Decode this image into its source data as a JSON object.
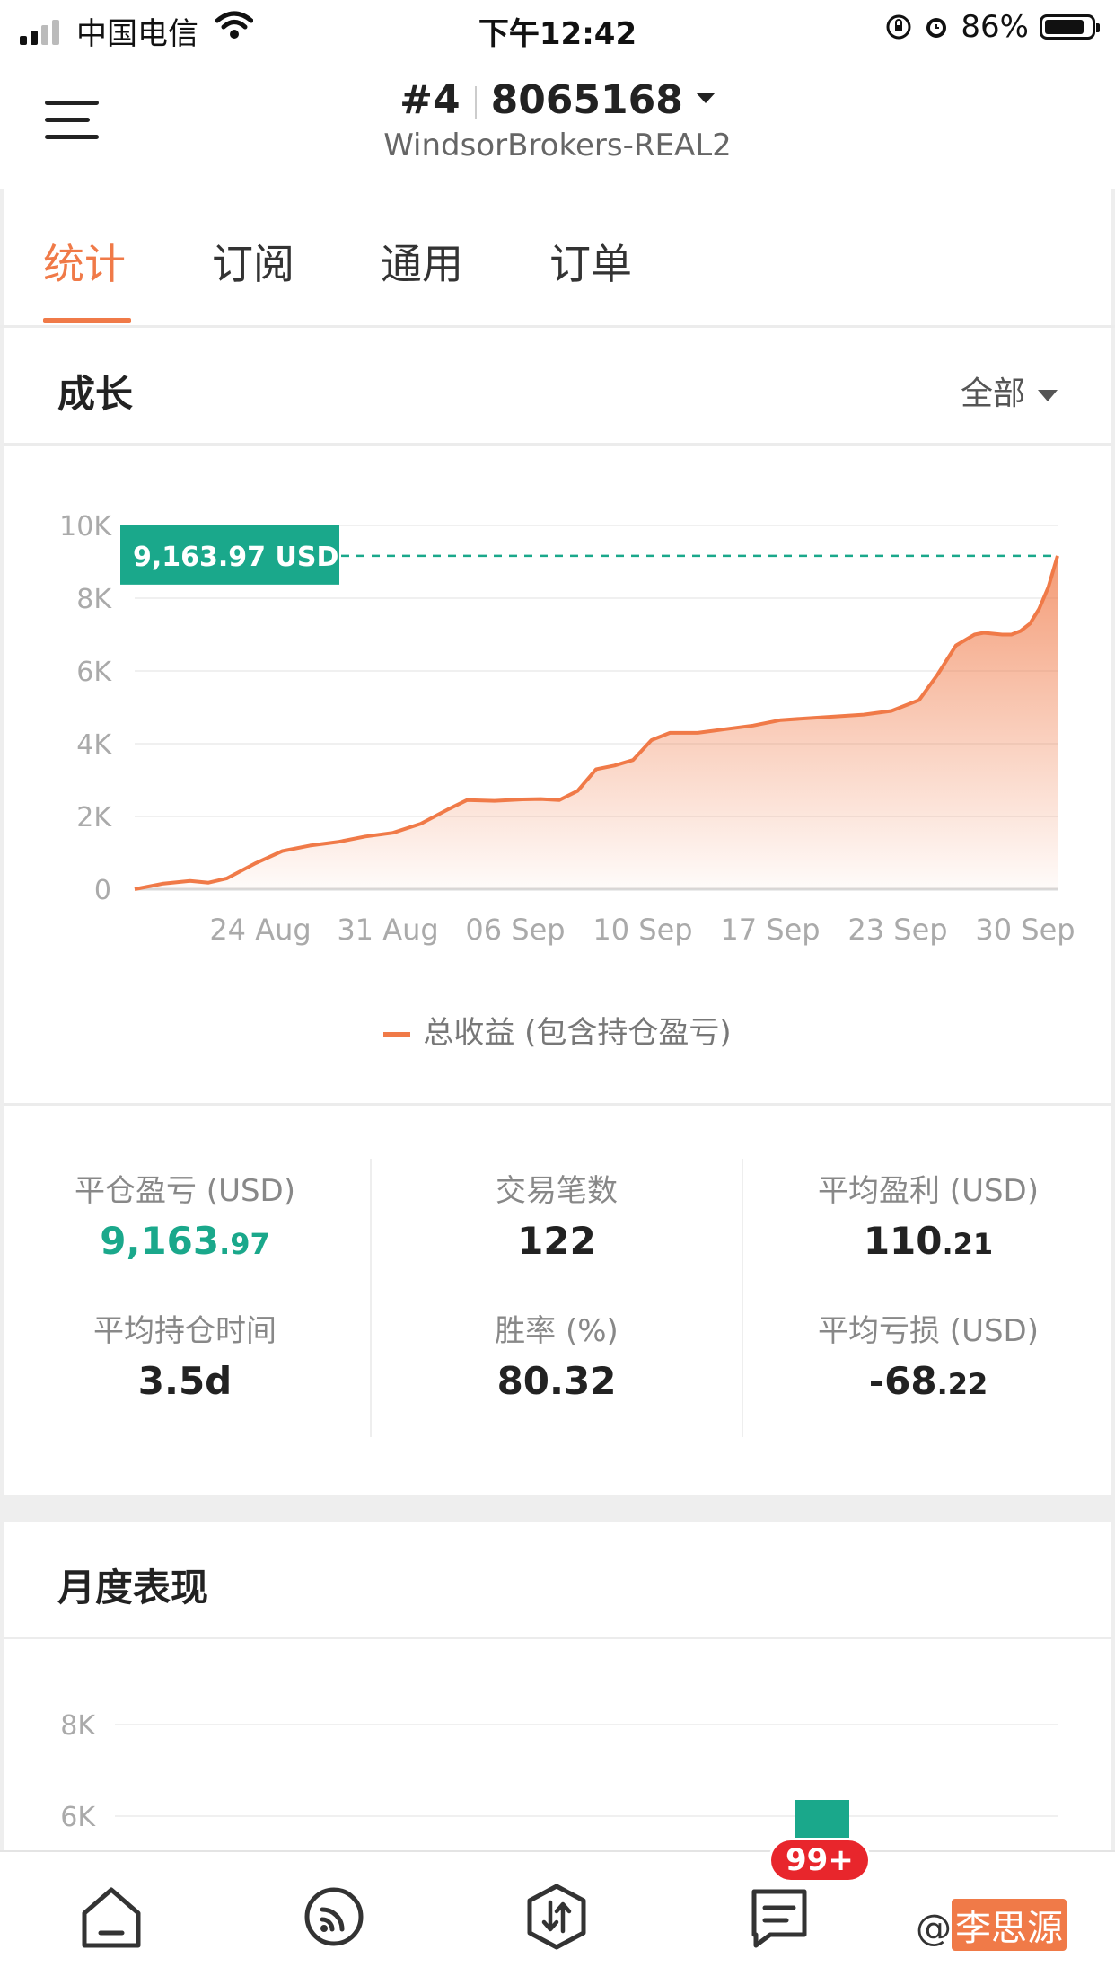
{
  "status_bar": {
    "carrier": "中国电信",
    "time": "下午12:42",
    "battery": "86%",
    "battery_level": 0.86
  },
  "header": {
    "account_index": "#4",
    "account_number": "8065168",
    "server": "WindsorBrokers-REAL2"
  },
  "tabs": [
    {
      "label": "统计",
      "active": true
    },
    {
      "label": "订阅",
      "active": false
    },
    {
      "label": "通用",
      "active": false
    },
    {
      "label": "订单",
      "active": false
    }
  ],
  "growth": {
    "title": "成长",
    "range_label": "全部",
    "current_value_label": "9,163.97 USD",
    "legend": "总收益 (包含持仓盈亏)"
  },
  "chart_data": [
    {
      "type": "area",
      "y_ticks": [
        "0",
        "2K",
        "4K",
        "6K",
        "8K",
        "10K"
      ],
      "x_ticks": [
        "24 Aug",
        "31 Aug",
        "06 Sep",
        "10 Sep",
        "17 Sep",
        "23 Sep",
        "30 Sep"
      ],
      "ylim": [
        0,
        10000
      ],
      "series": [
        {
          "name": "总收益 (包含持仓盈亏)",
          "color": "#f07a48",
          "points": [
            [
              0.0,
              0
            ],
            [
              0.03,
              150
            ],
            [
              0.06,
              230
            ],
            [
              0.08,
              180
            ],
            [
              0.1,
              300
            ],
            [
              0.13,
              700
            ],
            [
              0.16,
              1050
            ],
            [
              0.19,
              1200
            ],
            [
              0.22,
              1300
            ],
            [
              0.25,
              1450
            ],
            [
              0.28,
              1550
            ],
            [
              0.31,
              1800
            ],
            [
              0.34,
              2200
            ],
            [
              0.36,
              2450
            ],
            [
              0.39,
              2430
            ],
            [
              0.42,
              2470
            ],
            [
              0.44,
              2480
            ],
            [
              0.46,
              2450
            ],
            [
              0.48,
              2700
            ],
            [
              0.5,
              3300
            ],
            [
              0.52,
              3400
            ],
            [
              0.54,
              3550
            ],
            [
              0.56,
              4100
            ],
            [
              0.58,
              4300
            ],
            [
              0.61,
              4300
            ],
            [
              0.64,
              4400
            ],
            [
              0.67,
              4500
            ],
            [
              0.7,
              4650
            ],
            [
              0.73,
              4700
            ],
            [
              0.76,
              4750
            ],
            [
              0.79,
              4800
            ],
            [
              0.82,
              4900
            ],
            [
              0.85,
              5200
            ],
            [
              0.87,
              5900
            ],
            [
              0.89,
              6700
            ],
            [
              0.91,
              7000
            ],
            [
              0.92,
              7050
            ],
            [
              0.94,
              7000
            ],
            [
              0.95,
              7000
            ],
            [
              0.96,
              7100
            ],
            [
              0.97,
              7300
            ],
            [
              0.98,
              7700
            ],
            [
              0.99,
              8300
            ],
            [
              1.0,
              9163.97
            ]
          ]
        }
      ]
    },
    {
      "type": "bar",
      "y_ticks": [
        "6K",
        "8K"
      ],
      "values_visible": [
        6000
      ],
      "color": "#1aa88b"
    }
  ],
  "stats": {
    "closed_pnl": {
      "label": "平仓盈亏 (USD)",
      "int": "9,163",
      "dec": ".97"
    },
    "trades": {
      "label": "交易笔数",
      "value": "122"
    },
    "avg_profit": {
      "label": "平均盈利 (USD)",
      "int": "110",
      "dec": ".21"
    },
    "avg_hold": {
      "label": "平均持仓时间",
      "value": "3.5d"
    },
    "win_rate": {
      "label": "胜率 (%)",
      "value": "80.32"
    },
    "avg_loss": {
      "label": "平均亏损 (USD)",
      "int": "-68",
      "dec": ".22"
    }
  },
  "monthly": {
    "title": "月度表现"
  },
  "bottom_nav": {
    "badge": "99+",
    "items": [
      {
        "icon": "home-icon"
      },
      {
        "icon": "signal-feed-icon"
      },
      {
        "icon": "trade-icon"
      },
      {
        "icon": "message-icon"
      }
    ]
  },
  "watermark": {
    "prefix": "@",
    "name": "李思源"
  },
  "colors": {
    "accent": "#f07a48",
    "green": "#1aa88b"
  }
}
